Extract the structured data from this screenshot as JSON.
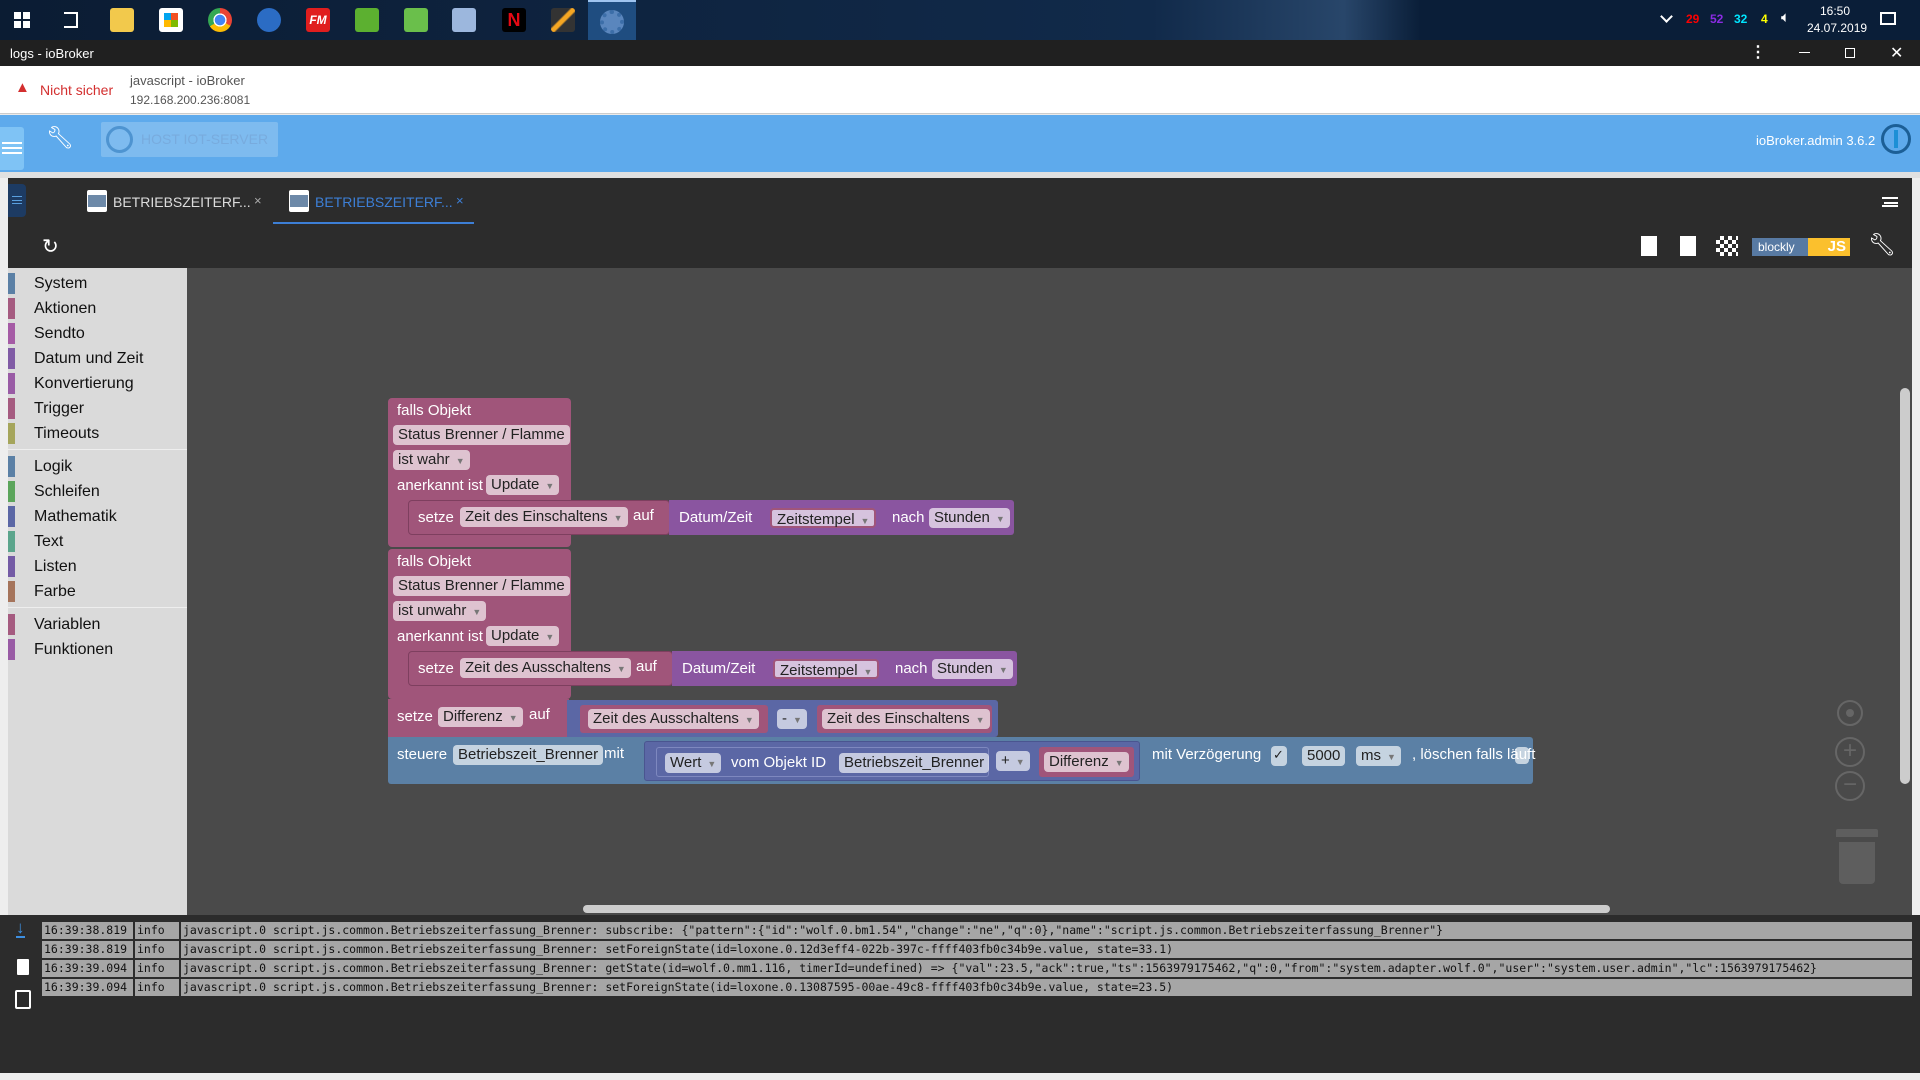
{
  "taskbar": {
    "icons": [
      "windows-start",
      "task-view",
      "file-explorer",
      "microsoft-store",
      "chrome",
      "thunderbird",
      "fm",
      "home-app",
      "loxone",
      "remote-desktop",
      "netflix",
      "winamp",
      "iobroker"
    ],
    "tray": {
      "n1": "29",
      "n2": "52",
      "n3": "32",
      "n4": "4",
      "n1_color": "#ff0000",
      "n2_color": "#8a2be2",
      "n3_color": "#00e5ff",
      "n4_color": "#ffff00",
      "time": "16:50",
      "date": "24.07.2019"
    }
  },
  "window": {
    "title": "logs - ioBroker"
  },
  "address": {
    "security": "Nicht sicher",
    "page_title": "javascript - ioBroker",
    "url": "192.168.200.236:8081"
  },
  "header": {
    "host_label": "HOST IOT-SERVER",
    "version": "ioBroker.admin 3.6.2"
  },
  "tabs": [
    {
      "label": "BETRIEBSZEITERF...",
      "active": false
    },
    {
      "label": "BETRIEBSZEITERF...",
      "active": true
    }
  ],
  "toolbar": {
    "blockly": "blockly",
    "js": "JS"
  },
  "sidebar": {
    "items": [
      {
        "label": "System",
        "color": "#5b80a5"
      },
      {
        "label": "Aktionen",
        "color": "#a55b80"
      },
      {
        "label": "Sendto",
        "color": "#a55ba5"
      },
      {
        "label": "Datum und Zeit",
        "color": "#805ba5"
      },
      {
        "label": "Konvertierung",
        "color": "#995ba5"
      },
      {
        "label": "Trigger",
        "color": "#a55b80"
      },
      {
        "label": "Timeouts",
        "color": "#a5a55b"
      },
      {
        "label": "Logik",
        "color": "#5b80a5"
      },
      {
        "label": "Schleifen",
        "color": "#5ba55b"
      },
      {
        "label": "Mathematik",
        "color": "#5b67a5"
      },
      {
        "label": "Text",
        "color": "#5ba58c"
      },
      {
        "label": "Listen",
        "color": "#745ba5"
      },
      {
        "label": "Farbe",
        "color": "#a5745b"
      },
      {
        "label": "Variablen",
        "color": "#a55b80"
      },
      {
        "label": "Funktionen",
        "color": "#995ba5"
      }
    ]
  },
  "blocks": {
    "b1": {
      "head": "falls Objekt",
      "obj": "Status Brenner / Flamme",
      "cond": "ist wahr",
      "ack_label": "anerkannt ist",
      "ack": "Update",
      "set": "setze",
      "var": "Zeit des Einschaltens",
      "auf": "auf",
      "dt": "Datum/Zeit",
      "ts": "Zeitstempel",
      "nach": "nach",
      "unit": "Stunden"
    },
    "b2": {
      "head": "falls Objekt",
      "obj": "Status Brenner / Flamme",
      "cond": "ist unwahr",
      "ack_label": "anerkannt ist",
      "ack": "Update",
      "set": "setze",
      "var": "Zeit des Ausschaltens",
      "auf": "auf",
      "dt": "Datum/Zeit",
      "ts": "Zeitstempel",
      "nach": "nach",
      "unit": "Stunden"
    },
    "b3": {
      "set": "setze",
      "var": "Differenz",
      "auf": "auf",
      "a": "Zeit des Ausschaltens",
      "op": "-",
      "b": "Zeit des Einschaltens"
    },
    "b4": {
      "steuere": "steuere",
      "target": "Betriebszeit_Brenner",
      "mit": "mit",
      "wert": "Wert",
      "vom": "vom Objekt ID",
      "obj": "Betriebszeit_Brenner",
      "op": "+",
      "add": "Differenz",
      "delay_label": "mit Verzögerung",
      "delay_checked": true,
      "delay": "5000",
      "delay_unit": "ms",
      "clear_label": ", löschen falls läuft",
      "clear_checked": false
    }
  },
  "logs": [
    {
      "time": "16:39:38.819",
      "level": "info",
      "msg": "javascript.0 script.js.common.Betriebszeiterfassung_Brenner: subscribe: {\"pattern\":{\"id\":\"wolf.0.bm1.54\",\"change\":\"ne\",\"q\":0},\"name\":\"script.js.common.Betriebszeiterfassung_Brenner\"}"
    },
    {
      "time": "16:39:38.819",
      "level": "info",
      "msg": "javascript.0 script.js.common.Betriebszeiterfassung_Brenner: setForeignState(id=loxone.0.12d3eff4-022b-397c-ffff403fb0c34b9e.value, state=33.1)"
    },
    {
      "time": "16:39:39.094",
      "level": "info",
      "msg": "javascript.0 script.js.common.Betriebszeiterfassung_Brenner: getState(id=wolf.0.mm1.116, timerId=undefined) => {\"val\":23.5,\"ack\":true,\"ts\":1563979175462,\"q\":0,\"from\":\"system.adapter.wolf.0\",\"user\":\"system.user.admin\",\"lc\":1563979175462}"
    },
    {
      "time": "16:39:39.094",
      "level": "info",
      "msg": "javascript.0 script.js.common.Betriebszeiterfassung_Brenner: setForeignState(id=loxone.0.13087595-00ae-49c8-ffff403fb0c34b9e.value, state=23.5)"
    }
  ]
}
